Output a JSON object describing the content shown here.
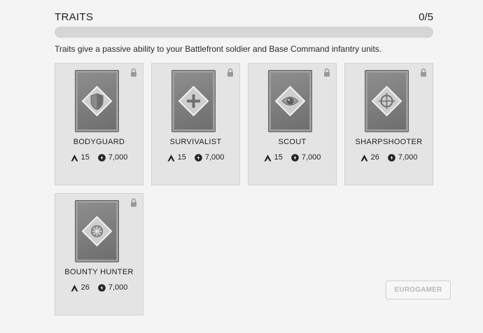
{
  "header": {
    "title": "TRAITS",
    "count": "0/5"
  },
  "progress": {
    "fraction": 0.0
  },
  "description": "Traits give a passive ability to your Battlefront soldier and Base Command infantry units.",
  "traits": [
    {
      "name": "BODYGUARD",
      "rank": "15",
      "cost": "7,000",
      "emblem": "shield-icon",
      "locked": true
    },
    {
      "name": "SURVIVALIST",
      "rank": "15",
      "cost": "7,000",
      "emblem": "cross-icon",
      "locked": true
    },
    {
      "name": "SCOUT",
      "rank": "15",
      "cost": "7,000",
      "emblem": "eye-icon",
      "locked": true
    },
    {
      "name": "SHARPSHOOTER",
      "rank": "26",
      "cost": "7,000",
      "emblem": "crosshair-icon",
      "locked": true
    },
    {
      "name": "BOUNTY HUNTER",
      "rank": "26",
      "cost": "7,000",
      "emblem": "starburst-icon",
      "locked": true
    }
  ],
  "watermark": "EUROGAMER"
}
